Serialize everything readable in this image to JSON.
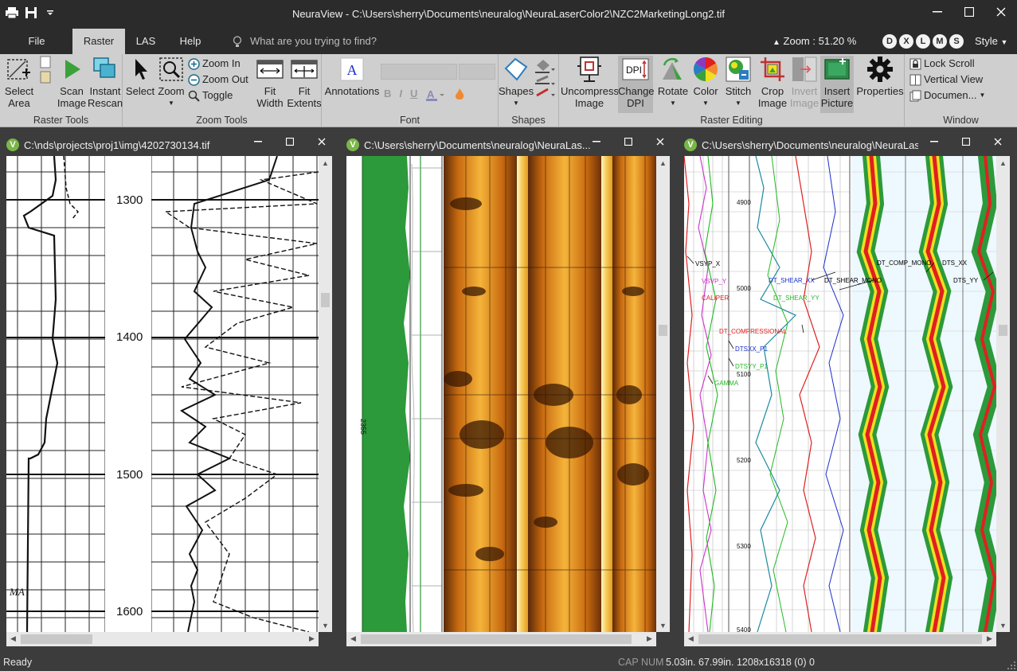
{
  "app": {
    "title": "NeuraView - C:\\Users\\sherry\\Documents\\neuralog\\NeuraLaserColor2\\NZC2MarketingLong2.tif"
  },
  "menu": {
    "tabs": [
      {
        "label": "File"
      },
      {
        "label": "Raster"
      },
      {
        "label": "LAS"
      },
      {
        "label": "Help"
      }
    ],
    "search_placeholder": "What are you trying to find?",
    "zoom_label": "Zoom : ",
    "zoom_value": "51.20 %",
    "brand_letters": [
      "D",
      "X",
      "L",
      "M",
      "S"
    ],
    "style_label": "Style"
  },
  "ribbon": {
    "raster_tools": {
      "label": "Raster Tools",
      "select_area": "Select Area",
      "scan_image": "Scan Image",
      "instant_rescan": "Instant Rescan"
    },
    "zoom_tools": {
      "label": "Zoom Tools",
      "select": "Select",
      "zoom": "Zoom",
      "zoom_in": "Zoom In",
      "zoom_out": "Zoom Out",
      "toggle": "Toggle",
      "fit_width": "Fit Width",
      "fit_extents": "Fit Extents"
    },
    "font": {
      "label": "Font",
      "annotations": "Annotations",
      "bold": "B",
      "italic": "I",
      "underline": "U"
    },
    "shapes": {
      "label": "Shapes",
      "shapes": "Shapes"
    },
    "raster_editing": {
      "label": "Raster Editing",
      "uncompress_image": "Uncompress Image",
      "change_dpi": "Change DPI",
      "rotate": "Rotate",
      "color": "Color",
      "stitch": "Stitch",
      "crop_image": "Crop Image",
      "invert_image": "Invert Image",
      "insert_picture": "Insert Picture",
      "properties": "Properties",
      "dpi_icon_text": "DPI"
    },
    "window": {
      "label": "Window",
      "lock_scroll": "Lock Scroll",
      "vertical_view": "Vertical View",
      "documents": "Documen..."
    }
  },
  "documents": [
    {
      "path": "C:\\nds\\projects\\proj1\\img\\4202730134.tif",
      "depth_labels": [
        "1300",
        "1400",
        "1500",
        "1600"
      ],
      "handwriting": "MA"
    },
    {
      "path": "C:\\Users\\sherry\\Documents\\neuralog\\NeuraLas...",
      "depth_labels": [
        "2355"
      ]
    },
    {
      "path": "C:\\Users\\sherry\\Documents\\neuralog\\NeuraLas...",
      "depth_labels": [
        "4900",
        "5000",
        "5100",
        "5200",
        "5300",
        "5400"
      ],
      "curve_labels": [
        {
          "text": "VSYP_X",
          "color": "#000000"
        },
        {
          "text": "VSVP_Y",
          "color": "#cc33cc"
        },
        {
          "text": "CALIPER",
          "color": "#e02020"
        },
        {
          "text": "DT_SHEAR_XX",
          "color": "#1a2fcc"
        },
        {
          "text": "DT_SHEAR_MONO",
          "color": "#000000"
        },
        {
          "text": "DT_SHEAR_YY",
          "color": "#22bb22"
        },
        {
          "text": "DT_COMPRESSIONAL",
          "color": "#e02020"
        },
        {
          "text": "DTSXX_P1",
          "color": "#1a2fcc"
        },
        {
          "text": "DTSYY_P1",
          "color": "#22bb22"
        },
        {
          "text": "GAMMA",
          "color": "#22bb22"
        },
        {
          "text": "DT_COMP_MONO",
          "color": "#000000"
        },
        {
          "text": "DTS_XX",
          "color": "#000000"
        },
        {
          "text": "DTS_YY",
          "color": "#000000"
        }
      ]
    }
  ],
  "status": {
    "ready": "Ready",
    "caps": "CAP NUM",
    "info": "5.03in. 67.99in. 1208x16318 (0) 0"
  },
  "colors": {
    "titlebar": "#2b2b2b",
    "ribbon": "#cfcfcf",
    "workspace": "#3c3c3c",
    "accent_green": "#7ab648"
  }
}
